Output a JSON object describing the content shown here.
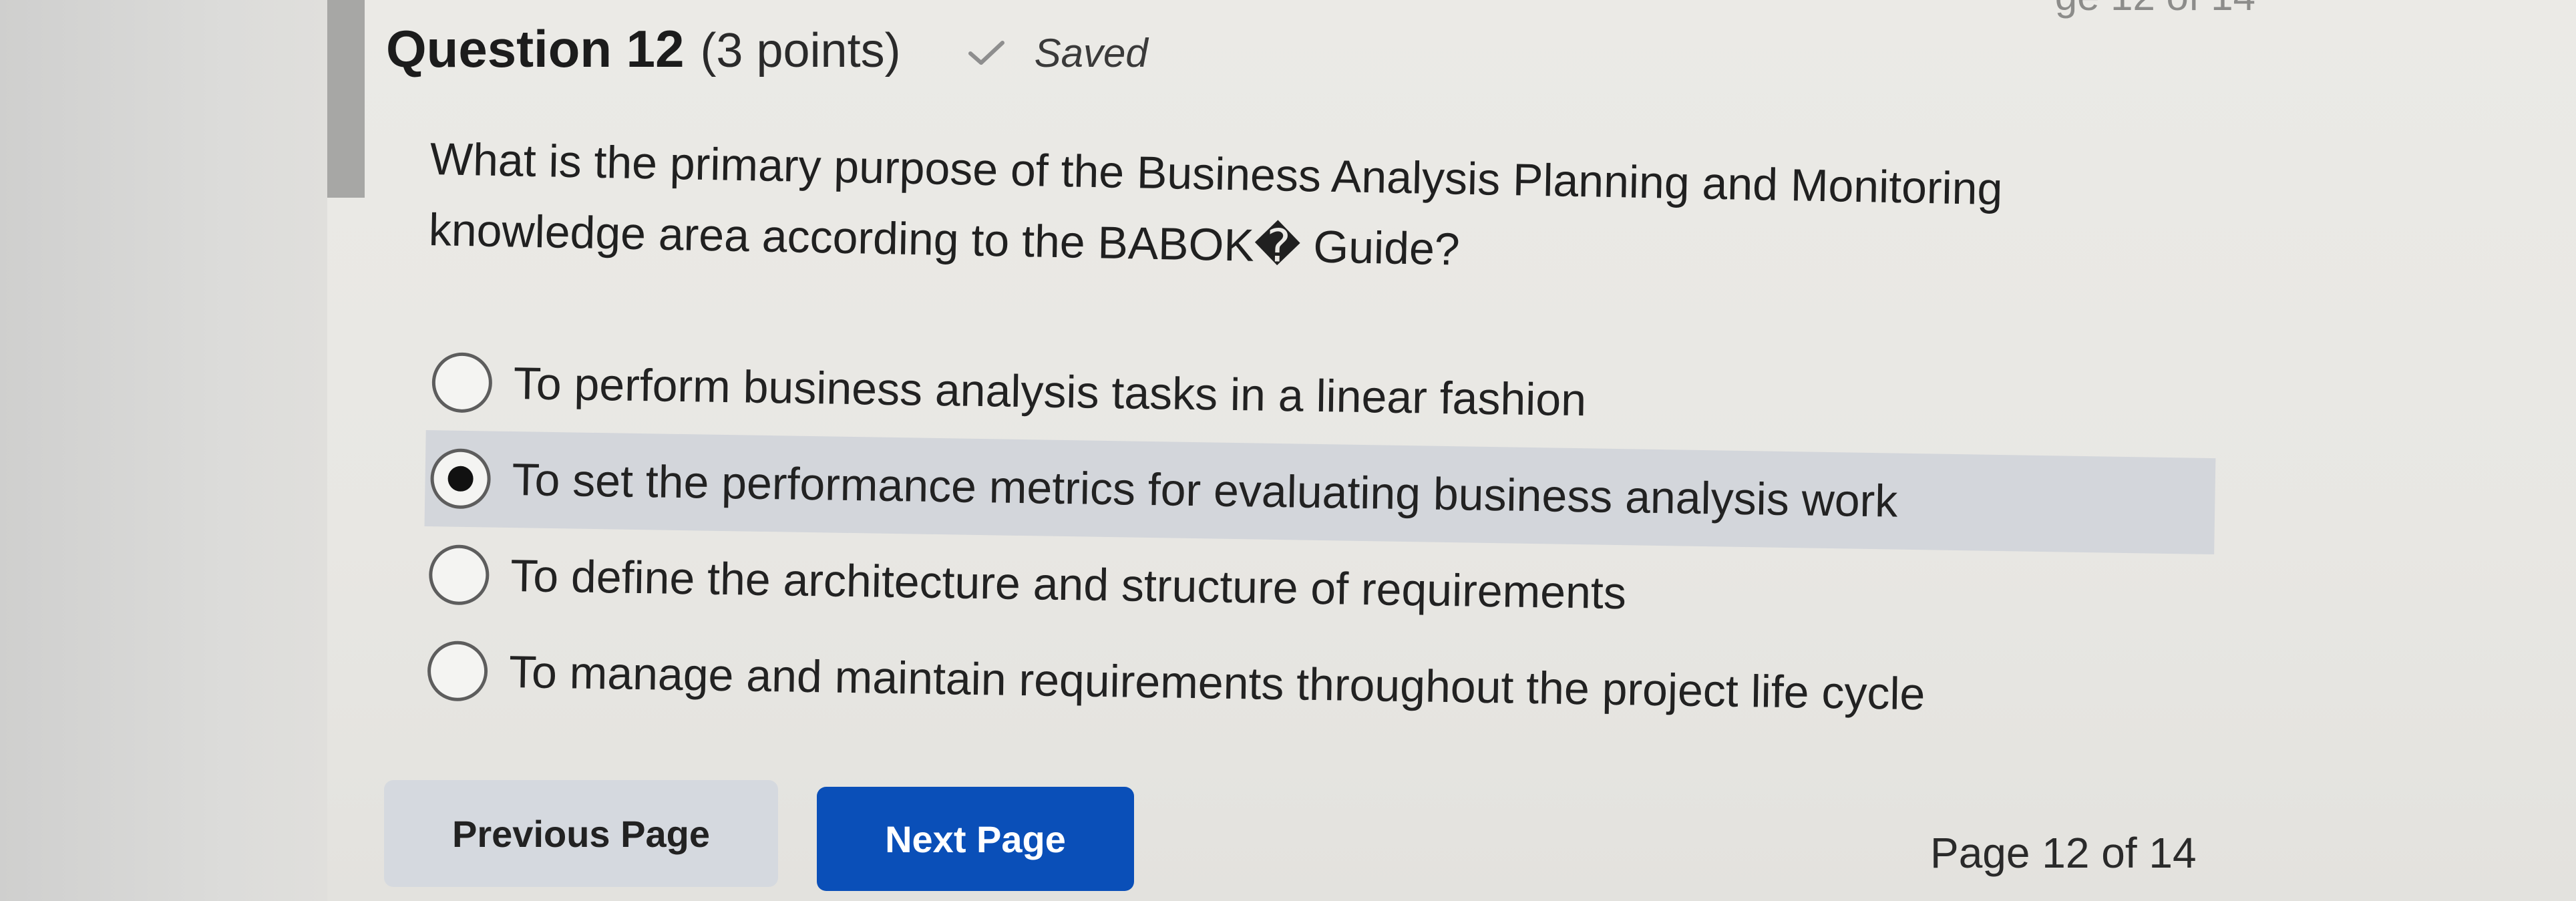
{
  "header": {
    "page_top_partial": "ge 12 of 14"
  },
  "question": {
    "title": "Question 12",
    "points": "(3 points)",
    "saved_label": "Saved",
    "text": "What is the primary purpose of the Business Analysis Planning and Monitoring knowledge area according to the BABOK� Guide?"
  },
  "options": [
    {
      "label": "To perform business analysis tasks in a linear fashion",
      "selected": false
    },
    {
      "label": "To set the performance metrics for evaluating business analysis work",
      "selected": true
    },
    {
      "label": "To define the architecture and structure of requirements",
      "selected": false
    },
    {
      "label": "To manage and maintain requirements throughout the project life cycle",
      "selected": false
    }
  ],
  "navigation": {
    "previous_label": "Previous Page",
    "next_label": "Next Page",
    "page_indicator": "Page 12 of 14"
  },
  "colors": {
    "next_button": "#0a4fb8",
    "previous_button": "#d5d9df",
    "selected_option_bg": "#d3d6db"
  },
  "icons": {
    "saved": "checkmark-icon"
  }
}
